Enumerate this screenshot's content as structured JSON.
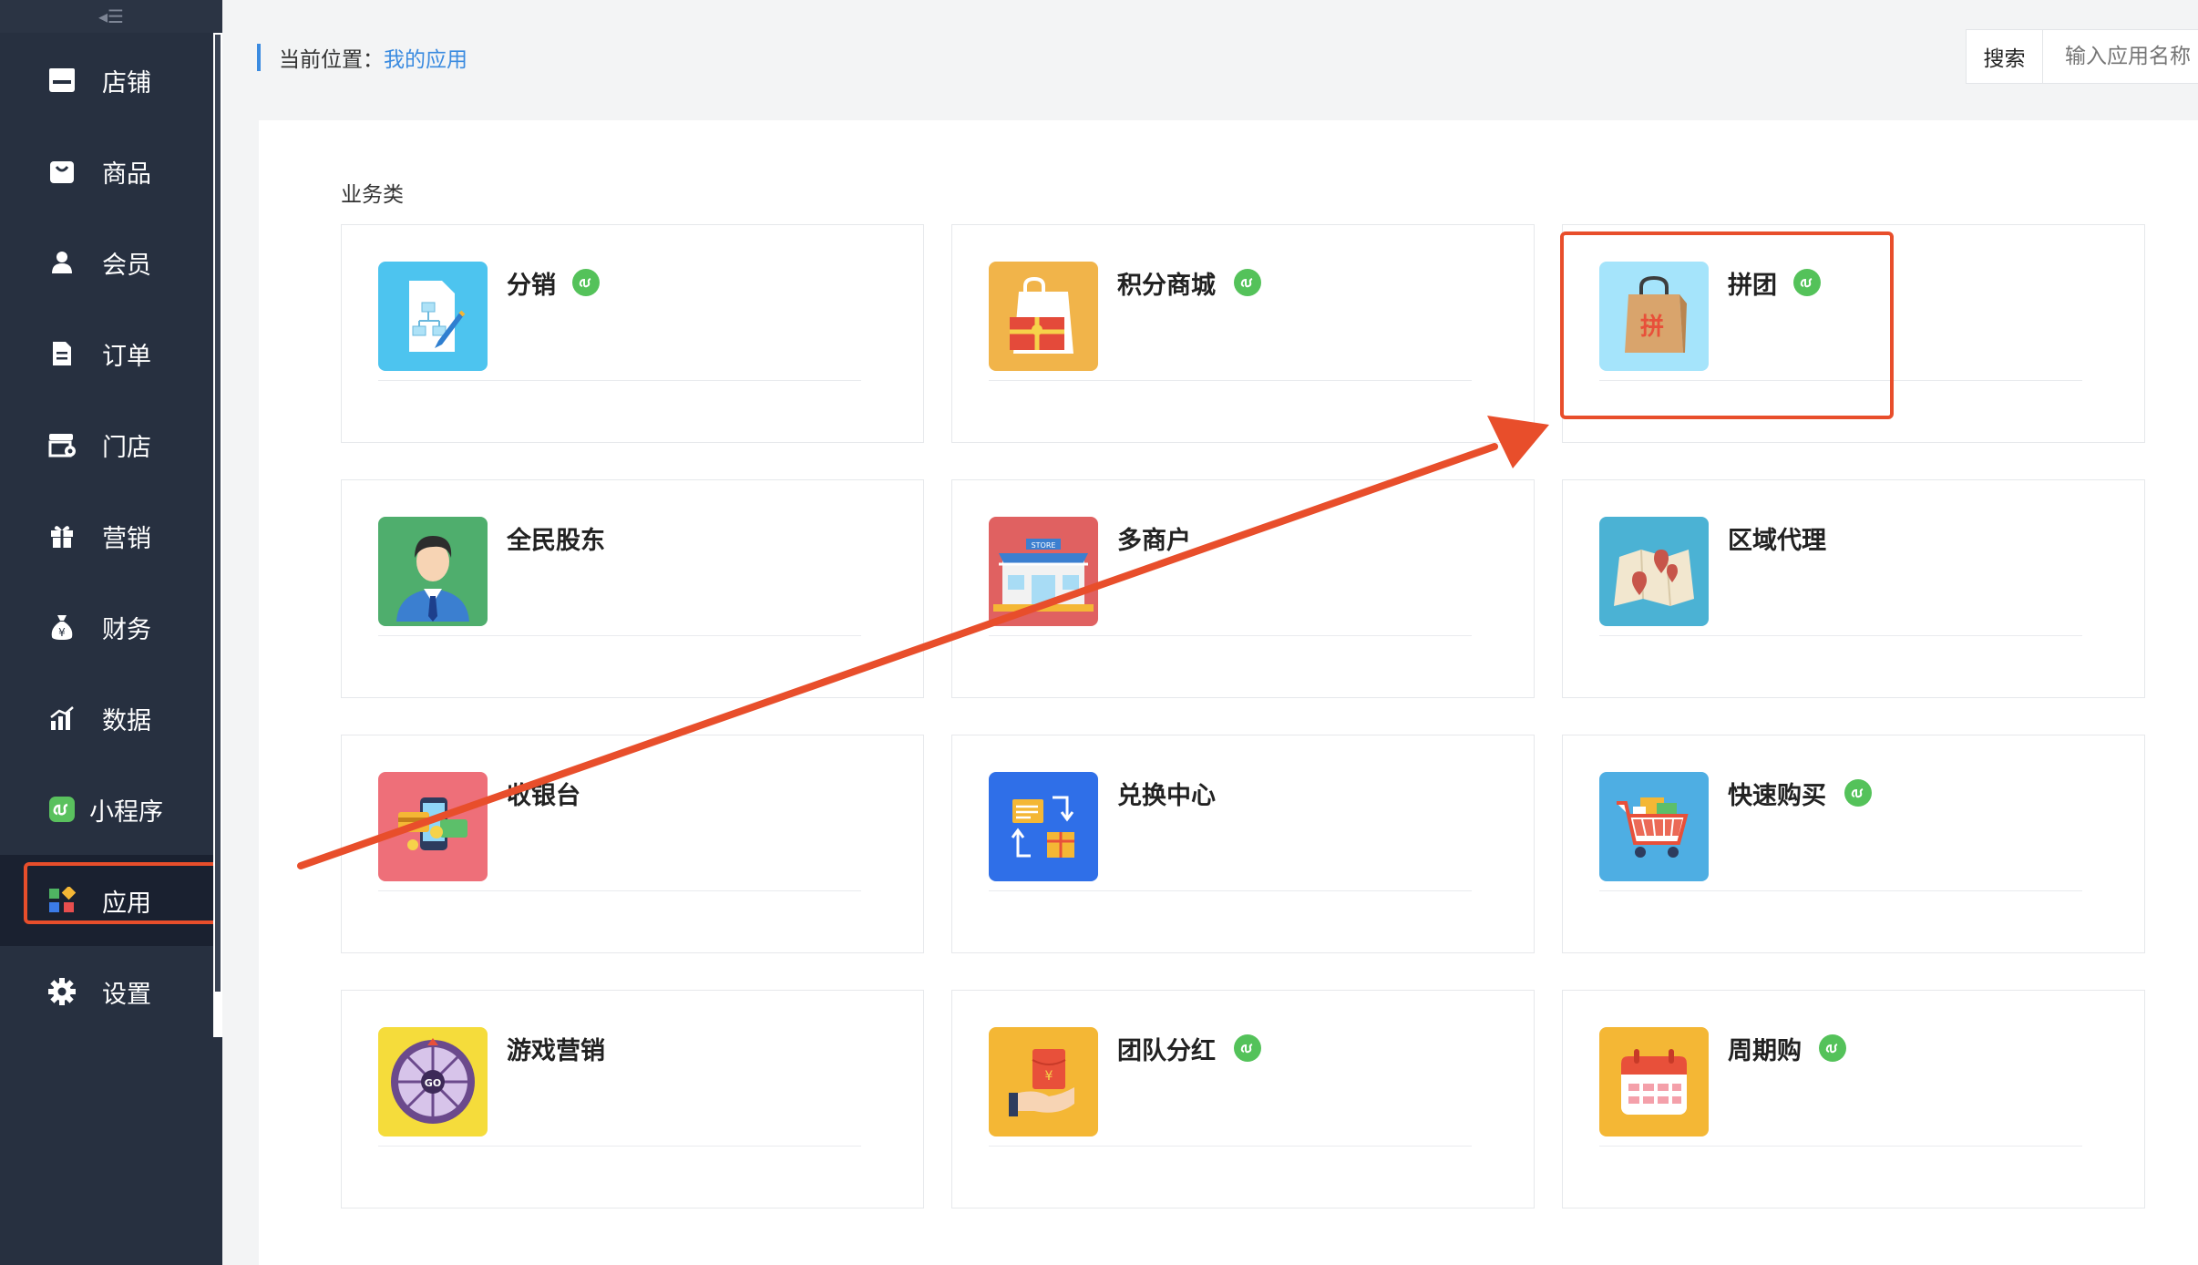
{
  "sidebar": {
    "collapse_glyph": "◂☰",
    "items": [
      {
        "label": "店铺",
        "icon": "shop-icon"
      },
      {
        "label": "商品",
        "icon": "goods-icon"
      },
      {
        "label": "会员",
        "icon": "member-icon"
      },
      {
        "label": "订单",
        "icon": "order-icon"
      },
      {
        "label": "门店",
        "icon": "store-icon"
      },
      {
        "label": "营销",
        "icon": "gift-icon"
      },
      {
        "label": "财务",
        "icon": "money-bag-icon"
      },
      {
        "label": "数据",
        "icon": "bar-chart-icon"
      },
      {
        "label": "小程序",
        "icon": "mini-program-icon"
      },
      {
        "label": "应用",
        "icon": "apps-icon",
        "active": true
      },
      {
        "label": "设置",
        "icon": "gear-icon"
      }
    ]
  },
  "breadcrumb": {
    "prefix": "当前位置：",
    "current": "我的应用"
  },
  "search": {
    "button_label": "搜索",
    "placeholder": "输入应用名称"
  },
  "section": {
    "title": "业务类"
  },
  "apps": [
    {
      "name": "分销",
      "icon": "distribution-icon",
      "color": "#4dc4ef",
      "mini_program": true
    },
    {
      "name": "积分商城",
      "icon": "points-mall-icon",
      "color": "#f1b44a",
      "mini_program": true
    },
    {
      "name": "拼团",
      "icon": "group-buy-bag-icon",
      "color": "#a5e4fb",
      "mini_program": true
    },
    {
      "name": "全民股东",
      "icon": "shareholder-icon",
      "color": "#4fae6d",
      "mini_program": false
    },
    {
      "name": "多商户",
      "icon": "multi-store-icon",
      "color": "#e06161",
      "mini_program": false
    },
    {
      "name": "区域代理",
      "icon": "region-map-icon",
      "color": "#4bb2d4",
      "mini_program": false
    },
    {
      "name": "收银台",
      "icon": "cashier-icon",
      "color": "#ee6f79",
      "mini_program": false
    },
    {
      "name": "兑换中心",
      "icon": "exchange-icon",
      "color": "#2f6fe8",
      "mini_program": false
    },
    {
      "name": "快速购买",
      "icon": "shopping-cart-icon",
      "color": "#4eaee3",
      "mini_program": true
    },
    {
      "name": "游戏营销",
      "icon": "wheel-game-icon",
      "color": "#f5dc3b",
      "mini_program": false
    },
    {
      "name": "团队分红",
      "icon": "red-envelope-icon",
      "color": "#f4b735",
      "mini_program": true
    },
    {
      "name": "周期购",
      "icon": "calendar-icon",
      "color": "#f4b735",
      "mini_program": true
    }
  ],
  "colors": {
    "accent": "#3b8be0",
    "annotation": "#e84e2b",
    "sidebar": "#273040",
    "mini_program_badge": "#54c25a"
  }
}
